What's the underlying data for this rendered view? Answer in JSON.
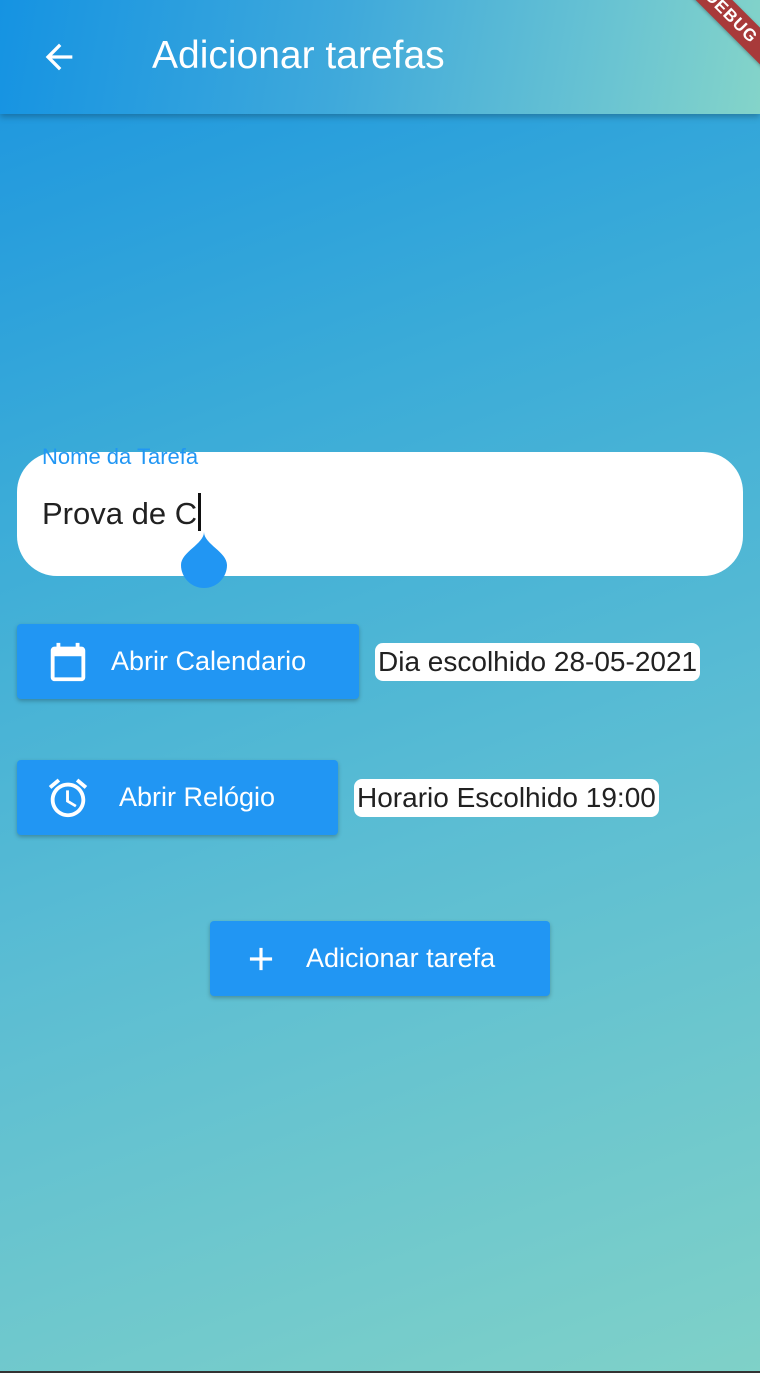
{
  "appbar": {
    "title": "Adicionar tarefas",
    "back_icon": "arrow-left-icon",
    "debug_banner": "DEBUG"
  },
  "form": {
    "task_name": {
      "label": "Nome da Tarefa",
      "value": "Prova de C"
    },
    "calendar_button": {
      "label": "Abrir Calendario",
      "icon": "calendar-icon"
    },
    "date_display": "Dia escolhido 28-05-2021",
    "clock_button": {
      "label": "Abrir Relógio",
      "icon": "alarm-clock-icon"
    },
    "time_display": "Horario Escolhido 19:00",
    "add_button": {
      "label": "Adicionar tarefa",
      "icon": "plus-icon"
    }
  },
  "colors": {
    "primary": "#2196f3",
    "gradient_start": "#1993e0",
    "gradient_end": "#7fd1c8",
    "debug_banner": "#a83a3a"
  }
}
